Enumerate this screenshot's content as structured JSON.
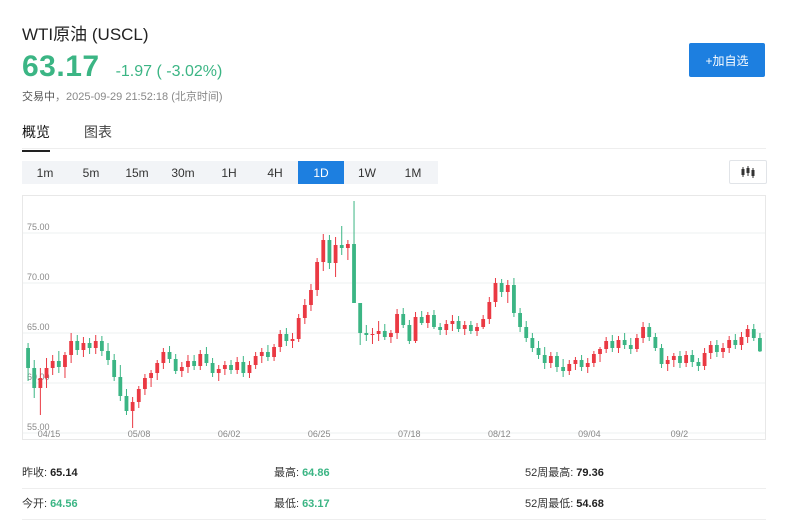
{
  "header": {
    "title": "WTI原油 (USCL)",
    "price": "63.17",
    "change": "-1.97 ( -3.02%)",
    "status": "交易中",
    "timestamp": "2025-09-29 21:52:18 (北京时间)",
    "add_button": "+加自选"
  },
  "tabs": [
    {
      "label": "概览",
      "active": true
    },
    {
      "label": "图表",
      "active": false
    }
  ],
  "periods": [
    "1m",
    "5m",
    "15m",
    "30m",
    "1H",
    "4H",
    "1D",
    "1W",
    "1M"
  ],
  "active_period": "1D",
  "chart_type_icon": "candlestick-icon",
  "colors": {
    "up": "#ea3943",
    "down": "#3bb584",
    "accent": "#1d7fe0"
  },
  "chart_data": {
    "type": "candlestick",
    "x_tick_labels": [
      "04/15",
      "05/08",
      "06/02",
      "06/25",
      "07/18",
      "08/12",
      "09/04",
      "09/2"
    ],
    "y_tick_labels": [
      "75.00",
      "70.00",
      "65.00",
      "60.00",
      "55.00"
    ],
    "y_ticks": [
      75,
      70,
      65,
      60,
      55
    ],
    "ylim": [
      54.8,
      78.3
    ],
    "grid": true,
    "series": [
      {
        "values": [
          [
            63.5,
            64.0,
            60.2,
            61.5
          ],
          [
            61.5,
            62.3,
            58.5,
            59.5
          ],
          [
            59.5,
            61.5,
            56.8,
            60.5
          ],
          [
            60.5,
            62.5,
            59.5,
            61.5
          ],
          [
            61.5,
            62.8,
            60.8,
            62.2
          ],
          [
            62.2,
            63.2,
            61.0,
            61.6
          ],
          [
            61.6,
            63.1,
            60.5,
            62.8
          ],
          [
            62.8,
            65.0,
            62.0,
            64.2
          ],
          [
            64.2,
            64.8,
            62.8,
            63.3
          ],
          [
            63.3,
            64.6,
            62.6,
            64.0
          ],
          [
            64.0,
            64.5,
            62.9,
            63.5
          ],
          [
            63.5,
            64.8,
            62.9,
            64.2
          ],
          [
            64.2,
            64.7,
            62.7,
            63.2
          ],
          [
            63.2,
            64.0,
            61.8,
            62.3
          ],
          [
            62.3,
            62.9,
            60.2,
            60.6
          ],
          [
            60.6,
            61.8,
            58.2,
            58.7
          ],
          [
            58.7,
            59.4,
            56.8,
            57.2
          ],
          [
            57.2,
            58.6,
            55.5,
            58.1
          ],
          [
            58.1,
            59.7,
            57.5,
            59.4
          ],
          [
            59.4,
            60.9,
            58.8,
            60.5
          ],
          [
            60.5,
            61.3,
            59.6,
            61.0
          ],
          [
            61.0,
            62.3,
            60.3,
            62.0
          ],
          [
            62.0,
            63.5,
            61.4,
            63.1
          ],
          [
            63.1,
            63.7,
            62.0,
            62.4
          ],
          [
            62.4,
            62.9,
            60.9,
            61.2
          ],
          [
            61.2,
            62.1,
            60.6,
            61.6
          ],
          [
            61.6,
            62.8,
            61.0,
            62.2
          ],
          [
            62.2,
            62.8,
            61.3,
            61.7
          ],
          [
            61.7,
            63.3,
            61.3,
            62.9
          ],
          [
            62.9,
            63.6,
            61.7,
            62.0
          ],
          [
            62.0,
            62.5,
            60.6,
            61.0
          ],
          [
            61.0,
            61.8,
            60.2,
            61.4
          ],
          [
            61.4,
            62.2,
            60.8,
            61.8
          ],
          [
            61.8,
            62.3,
            60.9,
            61.3
          ],
          [
            61.3,
            62.6,
            60.9,
            62.1
          ],
          [
            62.1,
            62.7,
            60.6,
            61.0
          ],
          [
            61.0,
            62.2,
            60.5,
            61.8
          ],
          [
            61.8,
            63.1,
            61.4,
            62.7
          ],
          [
            62.7,
            63.5,
            62.0,
            63.1
          ],
          [
            63.1,
            63.8,
            62.2,
            62.6
          ],
          [
            62.6,
            63.9,
            62.2,
            63.6
          ],
          [
            63.6,
            65.3,
            63.1,
            64.9
          ],
          [
            64.9,
            65.5,
            63.7,
            64.2
          ],
          [
            64.2,
            65.0,
            63.5,
            64.4
          ],
          [
            64.4,
            66.9,
            64.1,
            66.5
          ],
          [
            66.5,
            68.4,
            65.9,
            67.8
          ],
          [
            67.8,
            69.9,
            67.2,
            69.3
          ],
          [
            69.3,
            72.5,
            68.7,
            72.1
          ],
          [
            72.1,
            74.9,
            71.2,
            74.3
          ],
          [
            74.3,
            74.8,
            71.4,
            72.0
          ],
          [
            72.0,
            74.6,
            70.6,
            73.8
          ],
          [
            73.8,
            75.7,
            72.8,
            73.5
          ],
          [
            73.5,
            74.3,
            72.3,
            73.9
          ],
          [
            73.9,
            78.2,
            72.6,
            68.0
          ],
          [
            68.0,
            67.5,
            63.8,
            65.0
          ],
          [
            65.0,
            65.8,
            64.2,
            64.8
          ],
          [
            64.8,
            65.5,
            63.9,
            64.9
          ],
          [
            64.9,
            66.2,
            64.2,
            65.2
          ],
          [
            65.2,
            65.9,
            64.3,
            64.6
          ],
          [
            64.6,
            65.3,
            64.0,
            65.0
          ],
          [
            65.0,
            67.4,
            64.4,
            66.9
          ],
          [
            66.9,
            67.5,
            65.5,
            65.8
          ],
          [
            65.8,
            66.3,
            63.9,
            64.2
          ],
          [
            64.2,
            67.1,
            64.0,
            66.6
          ],
          [
            66.6,
            67.2,
            65.8,
            66.0
          ],
          [
            66.0,
            67.1,
            65.5,
            66.8
          ],
          [
            66.8,
            67.3,
            65.4,
            65.6
          ],
          [
            65.6,
            66.0,
            64.8,
            65.3
          ],
          [
            65.3,
            66.3,
            64.8,
            65.9
          ],
          [
            65.9,
            66.8,
            65.2,
            66.2
          ],
          [
            66.2,
            66.7,
            65.1,
            65.4
          ],
          [
            65.4,
            66.2,
            64.8,
            65.8
          ],
          [
            65.8,
            66.2,
            64.9,
            65.2
          ],
          [
            65.2,
            66.0,
            64.7,
            65.6
          ],
          [
            65.6,
            66.8,
            65.4,
            66.4
          ],
          [
            66.4,
            68.6,
            65.9,
            68.1
          ],
          [
            68.1,
            70.5,
            67.6,
            70.0
          ],
          [
            70.0,
            70.4,
            68.6,
            69.1
          ],
          [
            69.1,
            70.3,
            68.0,
            69.8
          ],
          [
            69.8,
            70.5,
            66.6,
            67.0
          ],
          [
            67.0,
            67.5,
            65.1,
            65.6
          ],
          [
            65.6,
            66.2,
            64.1,
            64.5
          ],
          [
            64.5,
            65.0,
            63.1,
            63.5
          ],
          [
            63.5,
            64.2,
            62.4,
            62.8
          ],
          [
            62.8,
            63.6,
            61.4,
            62.0
          ],
          [
            62.0,
            63.1,
            61.5,
            62.7
          ],
          [
            62.7,
            63.1,
            61.1,
            61.6
          ],
          [
            61.6,
            62.4,
            60.6,
            61.2
          ],
          [
            61.2,
            62.3,
            60.8,
            61.9
          ],
          [
            61.9,
            62.6,
            61.3,
            62.3
          ],
          [
            62.3,
            62.8,
            61.2,
            61.6
          ],
          [
            61.6,
            62.5,
            61.0,
            62.0
          ],
          [
            62.0,
            63.2,
            61.6,
            62.9
          ],
          [
            62.9,
            63.6,
            62.1,
            63.4
          ],
          [
            63.4,
            64.6,
            63.0,
            64.2
          ],
          [
            64.2,
            64.8,
            63.1,
            63.5
          ],
          [
            63.5,
            64.7,
            63.0,
            64.3
          ],
          [
            64.3,
            65.0,
            63.4,
            63.8
          ],
          [
            63.8,
            64.5,
            62.9,
            63.4
          ],
          [
            63.4,
            64.9,
            63.1,
            64.5
          ],
          [
            64.5,
            66.1,
            64.0,
            65.6
          ],
          [
            65.6,
            66.0,
            64.2,
            64.6
          ],
          [
            64.6,
            65.0,
            63.2,
            63.5
          ],
          [
            63.5,
            63.9,
            61.5,
            61.9
          ],
          [
            61.9,
            62.7,
            61.2,
            62.3
          ],
          [
            62.3,
            63.0,
            61.6,
            62.7
          ],
          [
            62.7,
            63.2,
            61.5,
            62.0
          ],
          [
            62.0,
            63.2,
            61.6,
            62.8
          ],
          [
            62.8,
            63.3,
            61.6,
            62.1
          ],
          [
            62.1,
            62.5,
            61.2,
            61.7
          ],
          [
            61.7,
            63.5,
            61.3,
            63.0
          ],
          [
            63.0,
            64.2,
            62.4,
            63.8
          ],
          [
            63.8,
            64.3,
            62.6,
            63.1
          ],
          [
            63.1,
            64.0,
            62.5,
            63.5
          ],
          [
            63.5,
            64.7,
            63.0,
            64.3
          ],
          [
            64.3,
            64.9,
            63.4,
            63.8
          ],
          [
            63.8,
            65.1,
            63.3,
            64.6
          ],
          [
            64.6,
            65.8,
            64.0,
            65.4
          ],
          [
            65.4,
            65.9,
            64.2,
            64.5
          ],
          [
            64.5,
            65.0,
            63.1,
            63.17
          ]
        ]
      }
    ]
  },
  "stats": {
    "prev_close_label": "昨收:",
    "prev_close": "65.14",
    "high_label": "最高:",
    "high": "64.86",
    "high52_label": "52周最高:",
    "high52": "79.36",
    "open_label": "今开:",
    "open": "64.56",
    "low_label": "最低:",
    "low": "63.17",
    "low52_label": "52周最低:",
    "low52": "54.68"
  }
}
